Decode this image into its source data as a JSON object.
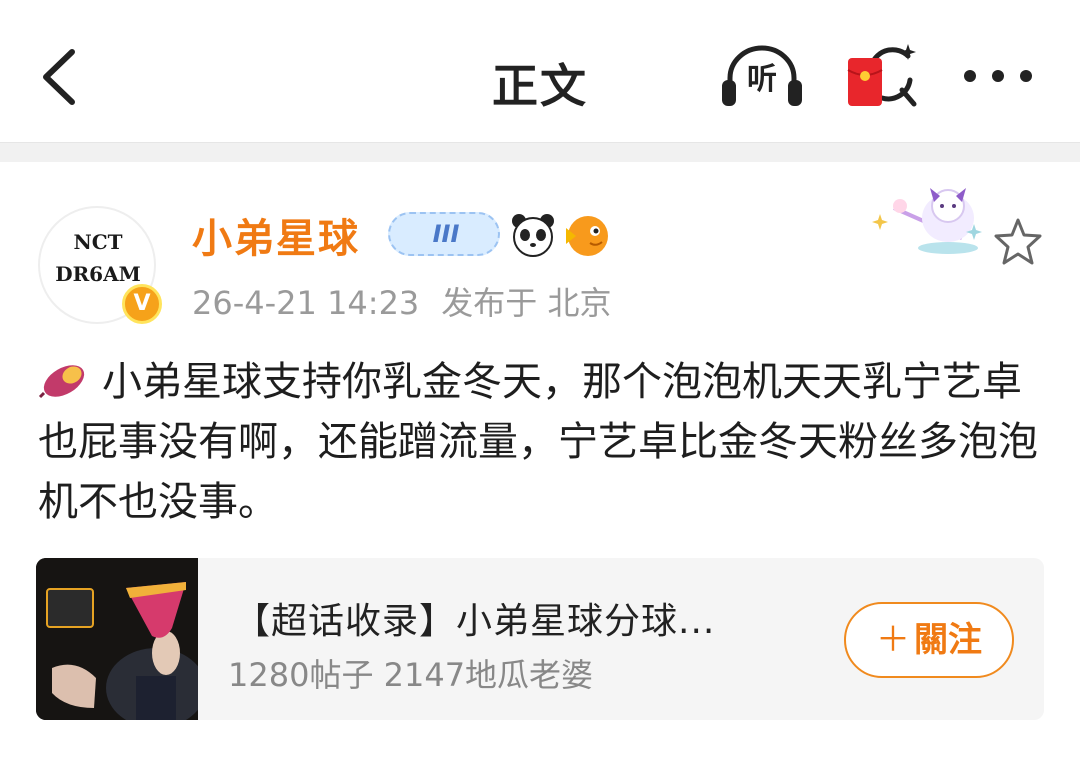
{
  "header": {
    "title": "正文",
    "listen_label": "听"
  },
  "post": {
    "author": {
      "name": "小弟星球",
      "avatar_line1": "NCT",
      "avatar_line2": "DR6AM",
      "verified_mark": "V",
      "level_badge": "III"
    },
    "timestamp": "26-4-21 14:23",
    "source": "发布于 北京",
    "text": "小弟星球支持你乳金冬天，那个泡泡机天天乳宁艺卓也屁事没有啊，还能蹭流量，宁艺卓比金冬天粉丝多泡泡机不也没事。"
  },
  "card": {
    "title": "【超话收录】小弟星球分球...",
    "subtitle": "1280帖子 2147地瓜老婆",
    "follow_label": "關注",
    "follow_prefix": "＋"
  },
  "colors": {
    "accent": "#f07a13",
    "meta_text": "#9a9a9a",
    "divider": "#f1f1f1"
  },
  "icons": [
    "back-icon",
    "listen-icon",
    "red-packet-icon",
    "more-icon",
    "star-icon",
    "sweet-potato-icon",
    "panda-icon",
    "fish-icon"
  ]
}
